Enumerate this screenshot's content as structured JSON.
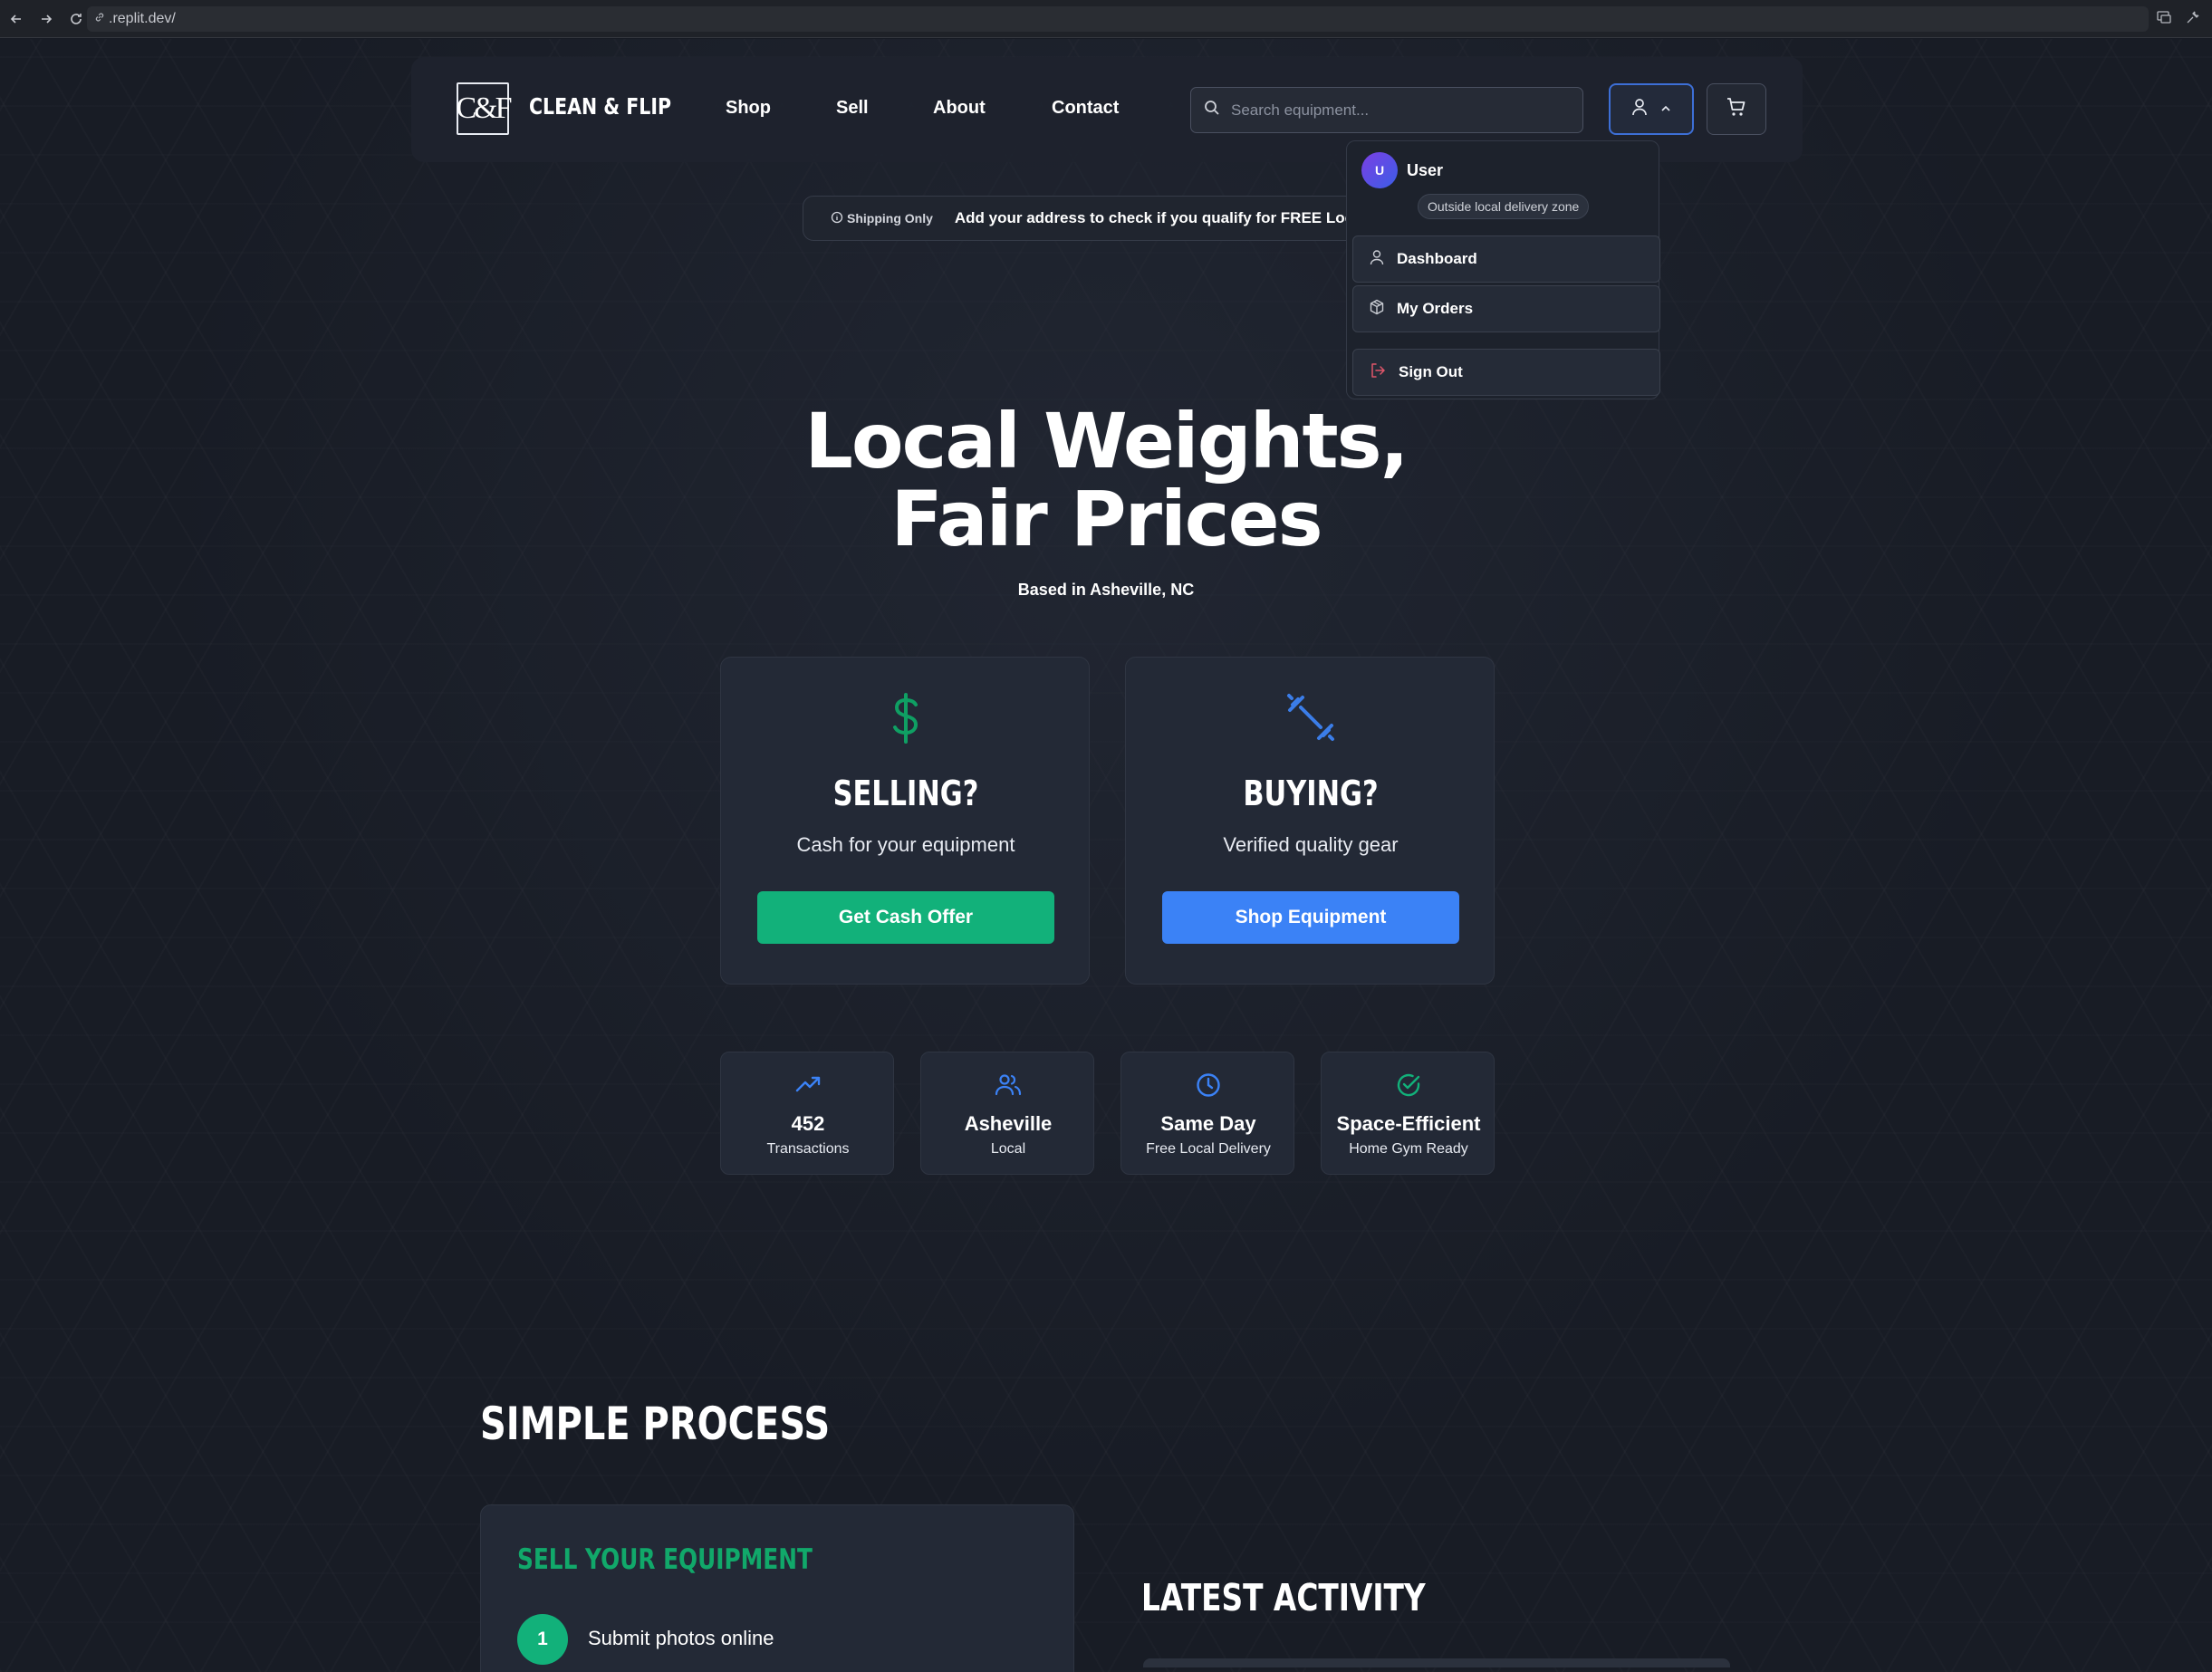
{
  "browser": {
    "url": ".replit.dev/"
  },
  "header": {
    "logo_mark": "C&F",
    "brand": "CLEAN & FLIP",
    "nav": [
      {
        "label": "Shop"
      },
      {
        "label": "Sell"
      },
      {
        "label": "About"
      },
      {
        "label": "Contact"
      }
    ],
    "search_placeholder": "Search equipment..."
  },
  "banner": {
    "tag": "Shipping Only",
    "message": "Add your address to check if you qualify for FREE Local Delivery"
  },
  "user_menu": {
    "avatar_initial": "U",
    "name": "User",
    "zone_badge": "Outside local delivery zone",
    "items": [
      {
        "label": "Dashboard",
        "icon": "user-icon"
      },
      {
        "label": "My Orders",
        "icon": "package-icon"
      },
      {
        "label": "Sign Out",
        "icon": "log-out-icon"
      }
    ]
  },
  "hero": {
    "title_line1": "Local Weights,",
    "title_line2": "Fair Prices",
    "subtitle": "Based in Asheville, NC"
  },
  "cta": [
    {
      "icon": "dollar-icon",
      "title": "SELLING?",
      "description": "Cash for your equipment",
      "button": "Get Cash Offer",
      "color": "#12b17a"
    },
    {
      "icon": "dumbbell-icon",
      "title": "BUYING?",
      "description": "Verified quality gear",
      "button": "Shop Equipment",
      "color": "#3b82f6"
    }
  ],
  "stats": [
    {
      "icon": "trending-up-icon",
      "value": "452",
      "label": "Transactions",
      "color": "#3b82f6"
    },
    {
      "icon": "users-icon",
      "value": "Asheville",
      "label": "Local",
      "color": "#3b82f6"
    },
    {
      "icon": "clock-icon",
      "value": "Same Day",
      "label": "Free Local Delivery",
      "color": "#3b82f6"
    },
    {
      "icon": "check-circle-icon",
      "value": "Space-Efficient",
      "label": "Home Gym Ready",
      "color": "#12b17a"
    }
  ],
  "process": {
    "title": "SIMPLE PROCESS",
    "card_title": "SELL YOUR EQUIPMENT",
    "steps": [
      {
        "number": "1",
        "text": "Submit photos online"
      }
    ]
  },
  "activity": {
    "title": "LATEST ACTIVITY"
  }
}
